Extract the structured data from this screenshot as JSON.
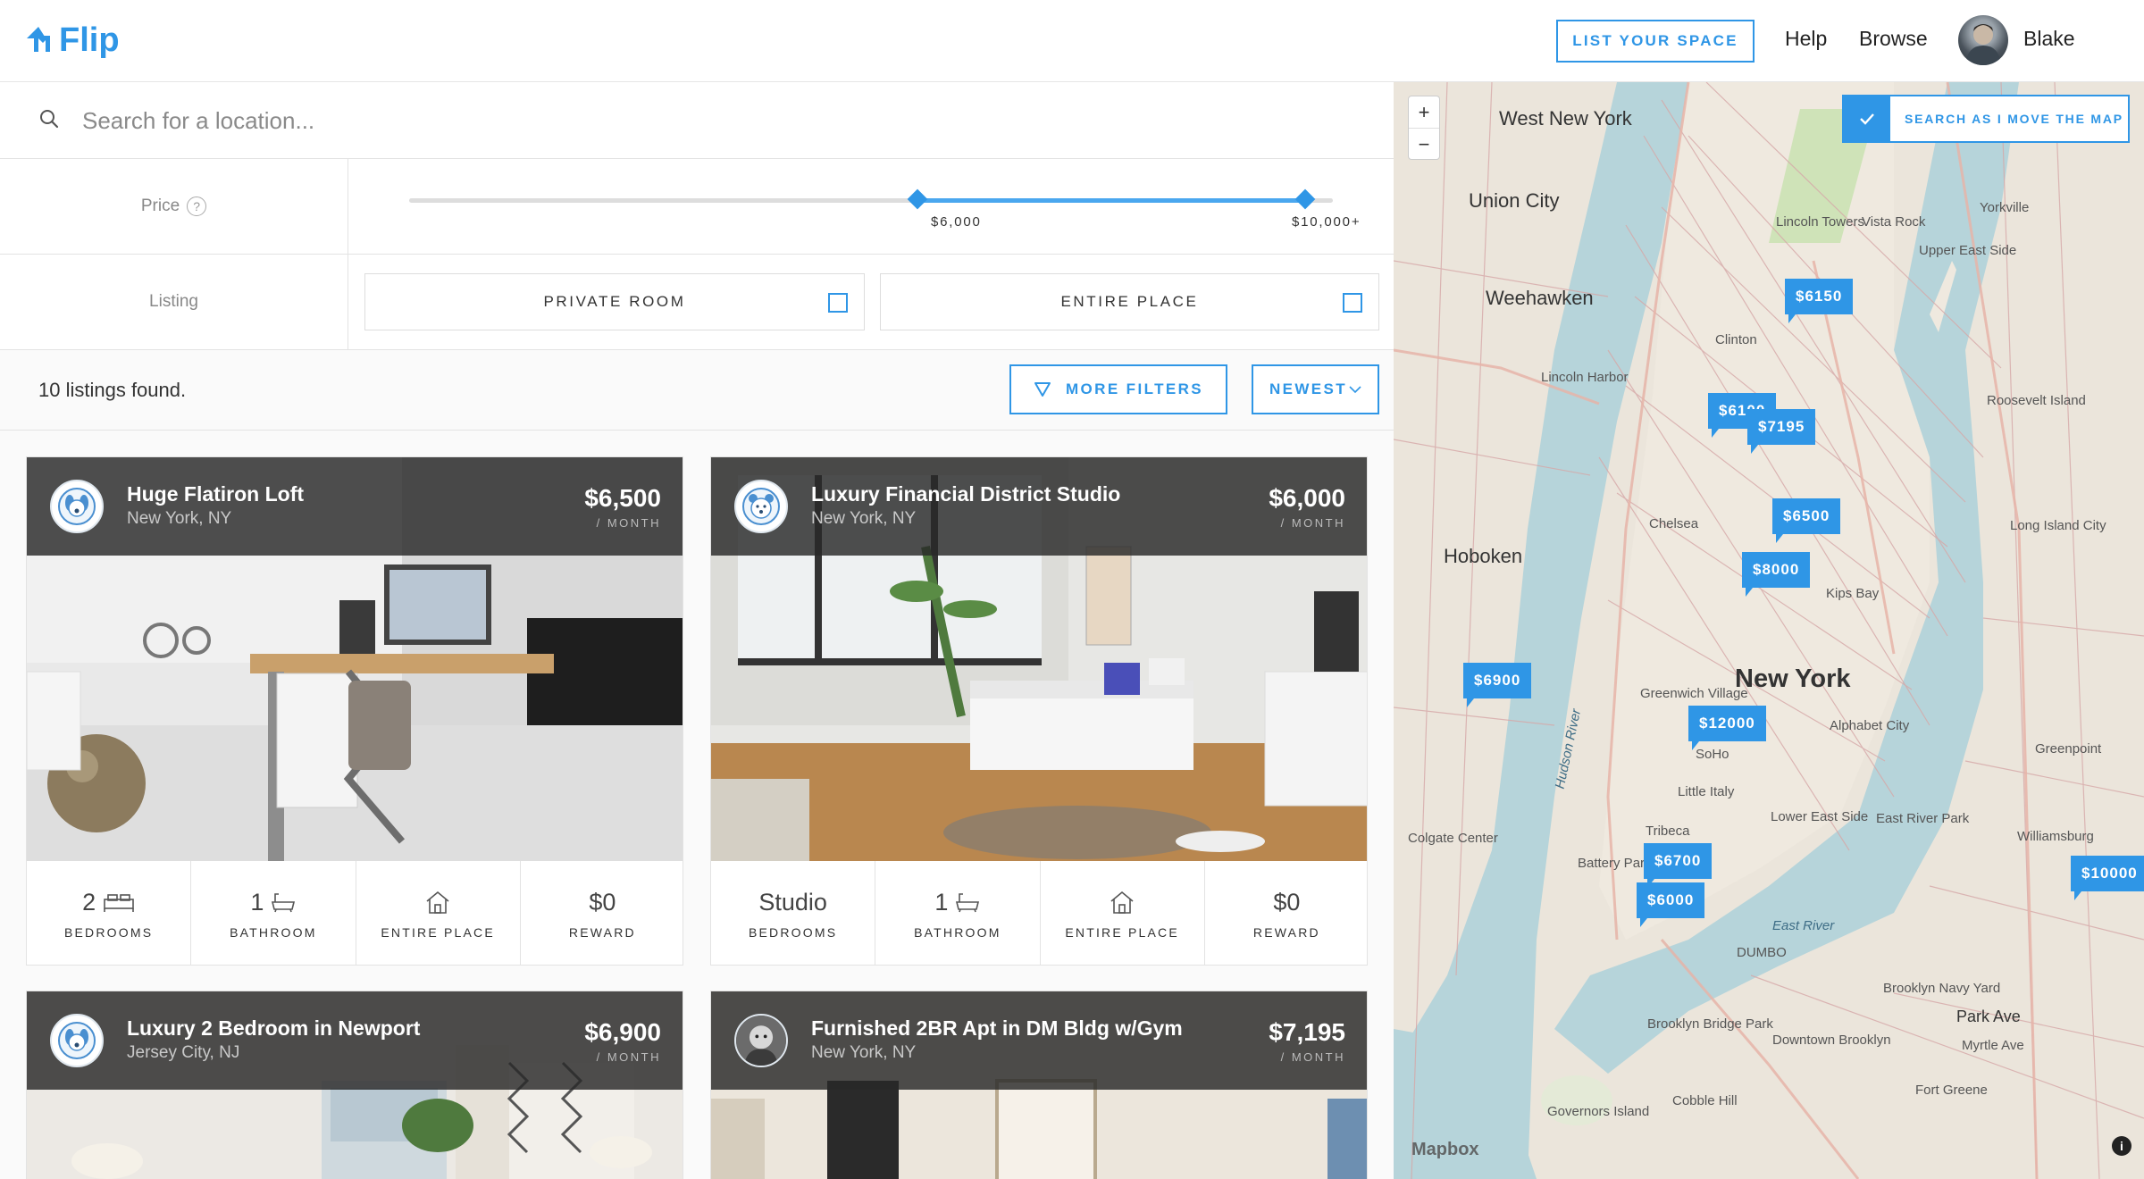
{
  "header": {
    "logo_text": "Flip",
    "list_space_label": "LIST YOUR SPACE",
    "help_label": "Help",
    "browse_label": "Browse",
    "user_name": "Blake"
  },
  "search": {
    "placeholder": "Search for a location..."
  },
  "filters": {
    "price_label": "Price",
    "price_help": "?",
    "price_min_label": "$6,000",
    "price_max_label": "$10,000+",
    "price_range_fraction": [
      0.55,
      0.97
    ],
    "listing_label": "Listing",
    "private_room_label": "PRIVATE ROOM",
    "entire_place_label": "ENTIRE PLACE"
  },
  "results": {
    "count_text": "10 listings found.",
    "more_filters_label": "MORE FILTERS",
    "sort_label": "NEWEST"
  },
  "listings": [
    {
      "title": "Huge Flatiron Loft",
      "location": "New York, NY",
      "price": "$6,500",
      "per": "/ MONTH",
      "stats": [
        {
          "value": "2",
          "label": "BEDROOMS"
        },
        {
          "value": "1",
          "label": "BATHROOM"
        },
        {
          "value": "",
          "label": "ENTIRE PLACE"
        },
        {
          "value": "$0",
          "label": "REWARD"
        }
      ]
    },
    {
      "title": "Luxury Financial District Studio",
      "location": "New York, NY",
      "price": "$6,000",
      "per": "/ MONTH",
      "stats": [
        {
          "value": "Studio",
          "label": "BEDROOMS"
        },
        {
          "value": "1",
          "label": "BATHROOM"
        },
        {
          "value": "",
          "label": "ENTIRE PLACE"
        },
        {
          "value": "$0",
          "label": "REWARD"
        }
      ]
    },
    {
      "title": "Luxury 2 Bedroom in Newport",
      "location": "Jersey City, NJ",
      "price": "$6,900",
      "per": "/ MONTH"
    },
    {
      "title": "Furnished 2BR Apt in DM Bldg w/Gym",
      "location": "New York, NY",
      "price": "$7,195",
      "per": "/ MONTH"
    }
  ],
  "map": {
    "search_as_move_label": "SEARCH AS I MOVE THE MAP",
    "zoom_in": "+",
    "zoom_out": "−",
    "attribution": "Mapbox",
    "info": "i",
    "pins": [
      "$6150",
      "$6100",
      "$7195",
      "$6500",
      "$8000",
      "$6900",
      "$12000",
      "$6700",
      "$6000",
      "$10000"
    ],
    "places": {
      "west_new_york": "West New York",
      "union_city": "Union City",
      "weehawken": "Weehawken",
      "hoboken": "Hoboken",
      "new_york": "New York",
      "lincoln_harbor": "Lincoln Harbor",
      "chelsea": "Chelsea",
      "greenwich_village": "Greenwich Village",
      "soho": "SoHo",
      "little_italy": "Little Italy",
      "tribeca": "Tribeca",
      "lower_east_side": "Lower East Side",
      "battery_park_city": "Battery Park City",
      "colgate_center": "Colgate Center",
      "dumbo": "DUMBO",
      "brooklyn_navy_yard": "Brooklyn Navy Yard",
      "park_ave": "Park Ave",
      "brooklyn_bridge_park": "Brooklyn Bridge Park",
      "downtown_brooklyn": "Downtown Brooklyn",
      "cobble_hill": "Cobble Hill",
      "governors_island": "Governors Island",
      "east_river": "East River",
      "hudson_river": "Hudson River",
      "greenpoint": "Greenpoint",
      "williamsburg": "Williamsburg",
      "long_island_city": "Long Island City",
      "roosevelt_island": "Roosevelt Island",
      "yorkville": "Yorkville",
      "upper_east_side": "Upper East Side",
      "vista_rock": "Vista Rock",
      "lincoln_towers": "Lincoln Towers",
      "clinton": "Clinton",
      "kips_bay": "Kips Bay",
      "alphabet_city": "Alphabet City",
      "east_river_park": "East River Park",
      "myrtle_ave": "Myrtle Ave",
      "fort_greene": "Fort Greene"
    }
  }
}
